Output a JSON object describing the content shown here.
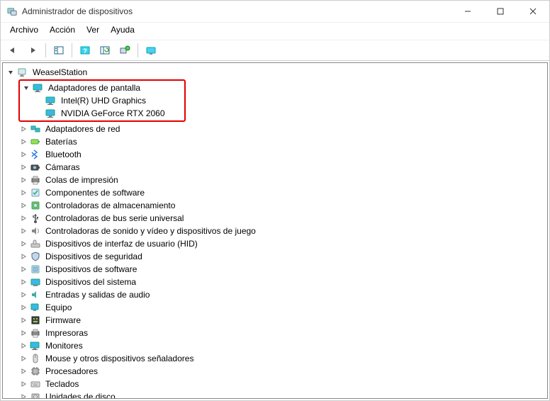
{
  "title": "Administrador de dispositivos",
  "menu": {
    "archivo": "Archivo",
    "accion": "Acción",
    "ver": "Ver",
    "ayuda": "Ayuda"
  },
  "root": "WeaselStation",
  "display_adapters": {
    "label": "Adaptadores de pantalla",
    "items": [
      "Intel(R) UHD Graphics",
      "NVIDIA GeForce RTX 2060"
    ]
  },
  "categories": [
    "Adaptadores de red",
    "Baterías",
    "Bluetooth",
    "Cámaras",
    "Colas de impresión",
    "Componentes de software",
    "Controladoras de almacenamiento",
    "Controladoras de bus serie universal",
    "Controladoras de sonido y vídeo y dispositivos de juego",
    "Dispositivos de interfaz de usuario (HID)",
    "Dispositivos de seguridad",
    "Dispositivos de software",
    "Dispositivos del sistema",
    "Entradas y salidas de audio",
    "Equipo",
    "Firmware",
    "Impresoras",
    "Monitores",
    "Mouse y otros dispositivos señaladores",
    "Procesadores",
    "Teclados",
    "Unidades de disco"
  ]
}
